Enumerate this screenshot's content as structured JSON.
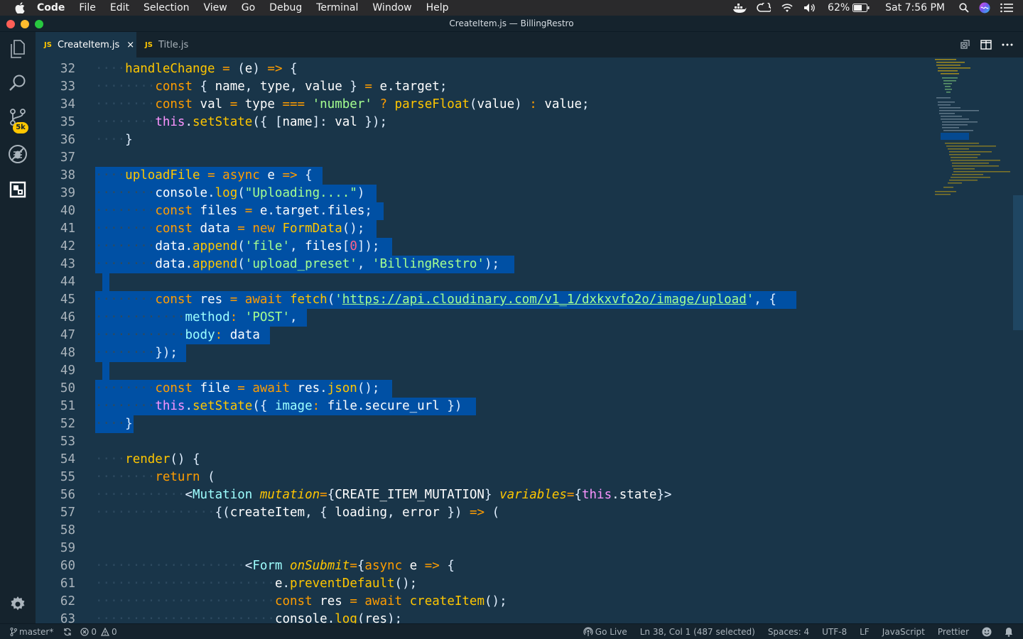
{
  "menubar": {
    "app": "Code",
    "items": [
      "File",
      "Edit",
      "Selection",
      "View",
      "Go",
      "Debug",
      "Terminal",
      "Window",
      "Help"
    ],
    "battery": "62%",
    "clock": "Sat 7:56 PM"
  },
  "window": {
    "title": "CreateItem.js — BillingRestro"
  },
  "activity": {
    "badge": "5k"
  },
  "tabs": [
    {
      "icon": "JS",
      "label": "CreateItem.js",
      "close": "×"
    },
    {
      "icon": "JS",
      "label": "Title.js"
    }
  ],
  "editor": {
    "line_numbers": [
      "32",
      "33",
      "34",
      "35",
      "36",
      "37",
      "38",
      "39",
      "40",
      "41",
      "42",
      "43",
      "44",
      "45",
      "46",
      "47",
      "48",
      "49",
      "50",
      "51",
      "52",
      "53",
      "54",
      "55",
      "56",
      "57",
      "58",
      "59",
      "60",
      "61",
      "62",
      "63"
    ]
  },
  "status": {
    "branch": "master*",
    "errors": "0",
    "warnings": "0",
    "golive": "Go Live",
    "position": "Ln 38, Col 1 (487 selected)",
    "spaces": "Spaces: 4",
    "encoding": "UTF-8",
    "eol": "LF",
    "language": "JavaScript",
    "formatter": "Prettier"
  },
  "colors": {
    "background": "#193549",
    "selection": "#0050a4",
    "accent": "#ffc600"
  }
}
